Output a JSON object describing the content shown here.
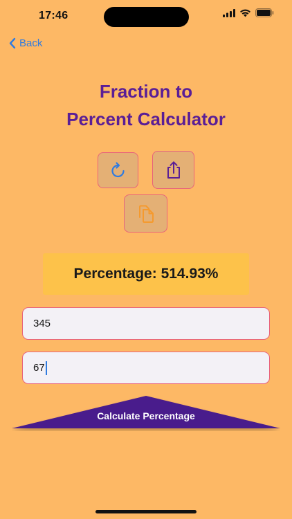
{
  "status_bar": {
    "time": "17:46",
    "icons": [
      "signal-icon",
      "wifi-icon",
      "battery-icon"
    ]
  },
  "nav": {
    "back_label": "Back"
  },
  "title": {
    "line1": "Fraction to",
    "line2": "Percent Calculator"
  },
  "actions": {
    "refresh_icon": "refresh-icon",
    "share_icon": "share-icon",
    "copy_icon": "copy-icon"
  },
  "result": {
    "text": "Percentage: 514.93%"
  },
  "inputs": {
    "numerator_value": "345",
    "denominator_value": "67"
  },
  "calculate_button": {
    "label": "Calculate Percentage"
  },
  "colors": {
    "background": "#FDB865",
    "title": "#5A1E96",
    "accent_blue": "#2F7BE0",
    "border_pink": "#E8637A",
    "result_bg": "#FDC24A",
    "button_purple": "#4A1A8C",
    "copy_icon": "#F59A2E"
  }
}
